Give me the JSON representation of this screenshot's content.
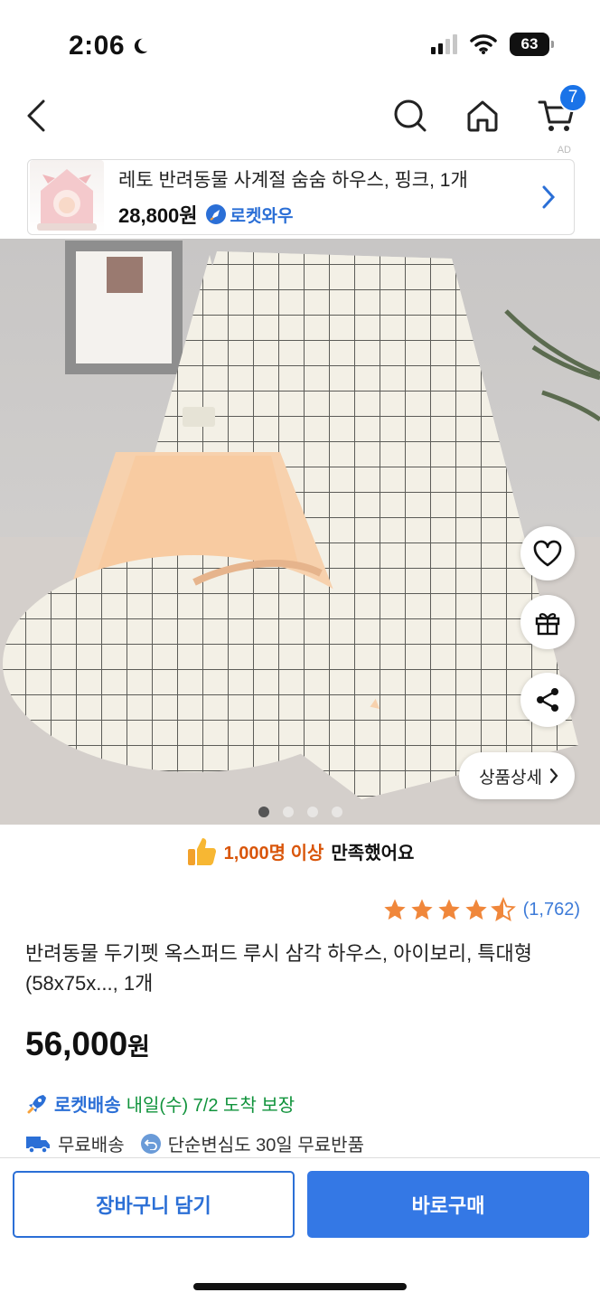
{
  "status_bar": {
    "time": "2:06",
    "battery": "63"
  },
  "nav": {
    "cart_count": "7"
  },
  "ad": {
    "mark": "AD",
    "title": "레토 반려동물 사계절 숨숨 하우스, 핑크, 1개",
    "price": "28,800원",
    "badge": "로켓와우"
  },
  "hero": {
    "detail_label": "상품상세",
    "dots_total": 4,
    "dots_active": 1
  },
  "satisfaction": {
    "highlight": "1,000명 이상",
    "text": "만족했어요"
  },
  "rating": {
    "stars": 4.5,
    "count": "(1,762)"
  },
  "product": {
    "title": "반려동물 두기펫 옥스퍼드 루시 삼각 하우스, 아이보리, 특대형(58x75x..., 1개",
    "price_number": "56,000",
    "price_unit": "원"
  },
  "delivery": {
    "rocket_label": "로켓배송",
    "info": "내일(수) 7/2 도착 보장",
    "free_shipping": "무료배송",
    "free_return": "단순변심도 30일 무료반품"
  },
  "actions": {
    "cart_button": "장바구니 담기",
    "buy_button": "바로구매"
  },
  "colors": {
    "accent": "#3478e5",
    "rocket": "#2b6fd6",
    "orange": "#d9560b",
    "green": "#11933c",
    "star": "#f0873b"
  }
}
